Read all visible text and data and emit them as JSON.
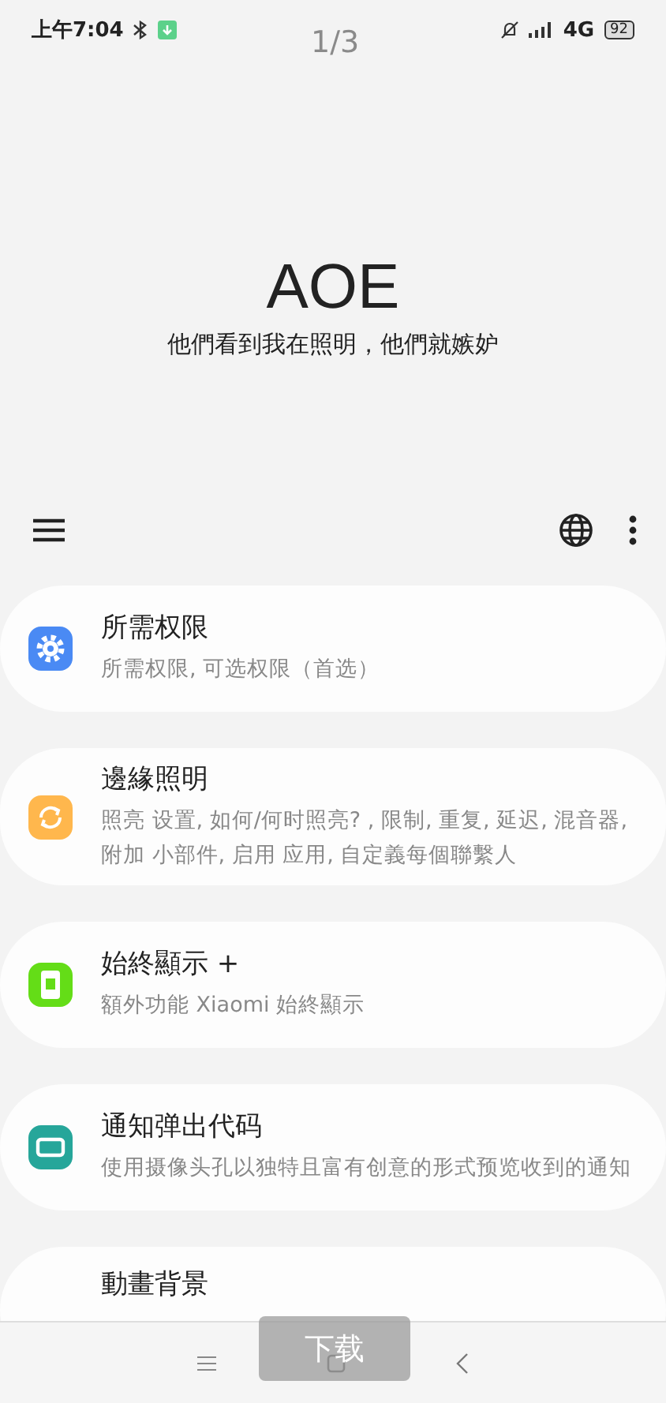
{
  "status_bar": {
    "time": "上午7:04",
    "network": "4G",
    "battery": "92"
  },
  "page_indicator": "1/3",
  "header": {
    "title": "AOE",
    "subtitle": "他們看到我在照明，他們就嫉妒"
  },
  "menu": [
    {
      "kind": "gear",
      "color": "#4a8af4",
      "title": "所需权限",
      "subtitle": "所需权限, 可选权限（首选）"
    },
    {
      "kind": "sync",
      "color": "#ffb74d",
      "title": "邊緣照明",
      "subtitle": "照亮 设置, 如何/何时照亮? , 限制, 重复, 延迟, 混音器, 附加 小部件, 启用 应用, 自定義每個聯繫人"
    },
    {
      "kind": "phone",
      "color": "#64dd17",
      "title": "始終顯示 +",
      "subtitle": "額外功能 Xiaomi 始終顯示"
    },
    {
      "kind": "screen",
      "color": "#26a69a",
      "title": "通知弹出代码",
      "subtitle": "使用摄像头孔以独特且富有创意的形式预览收到的通知"
    },
    {
      "title": "動畫背景"
    }
  ],
  "toast": "下载"
}
